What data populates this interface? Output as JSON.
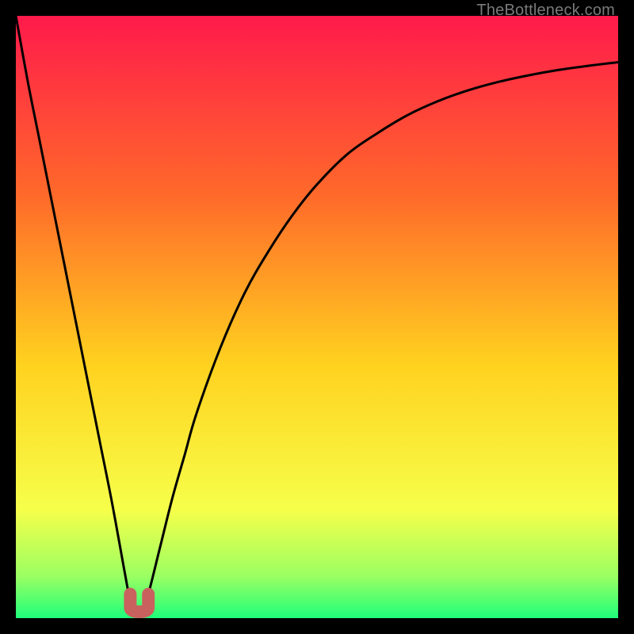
{
  "attribution": "TheBottleneck.com",
  "colors": {
    "gradient_top": "#ff1a4b",
    "gradient_upper_mid": "#ff6a2a",
    "gradient_mid": "#ffd21f",
    "gradient_lower_mid": "#f6ff4a",
    "gradient_low": "#9bff62",
    "gradient_bottom": "#1eff7a",
    "curve": "#000000",
    "marker": "#c9615e",
    "frame": "#000000"
  },
  "chart_data": {
    "type": "line",
    "title": "",
    "xlabel": "",
    "ylabel": "",
    "xlim": [
      0,
      100
    ],
    "ylim": [
      0,
      100
    ],
    "legend": false,
    "grid": false,
    "annotations": [],
    "series": [
      {
        "name": "curve",
        "x": [
          0,
          2,
          4,
          6,
          8,
          10,
          12,
          14,
          16,
          18,
          19,
          20,
          21,
          22,
          24,
          26,
          28,
          30,
          34,
          38,
          42,
          46,
          50,
          55,
          60,
          65,
          70,
          75,
          80,
          85,
          90,
          95,
          100
        ],
        "y": [
          100,
          89,
          79,
          69,
          59,
          49,
          39,
          29,
          19,
          8,
          3,
          1,
          1,
          4,
          12,
          20,
          27,
          34,
          45,
          54,
          61,
          67,
          72,
          77,
          80.5,
          83.5,
          85.8,
          87.6,
          89,
          90.1,
          91,
          91.7,
          92.3
        ]
      }
    ],
    "marker": {
      "name": "valley-marker",
      "shape": "u",
      "x_center": 20.5,
      "x_left": 19,
      "x_right": 22,
      "y_top": 4,
      "y_bottom": 0
    }
  }
}
